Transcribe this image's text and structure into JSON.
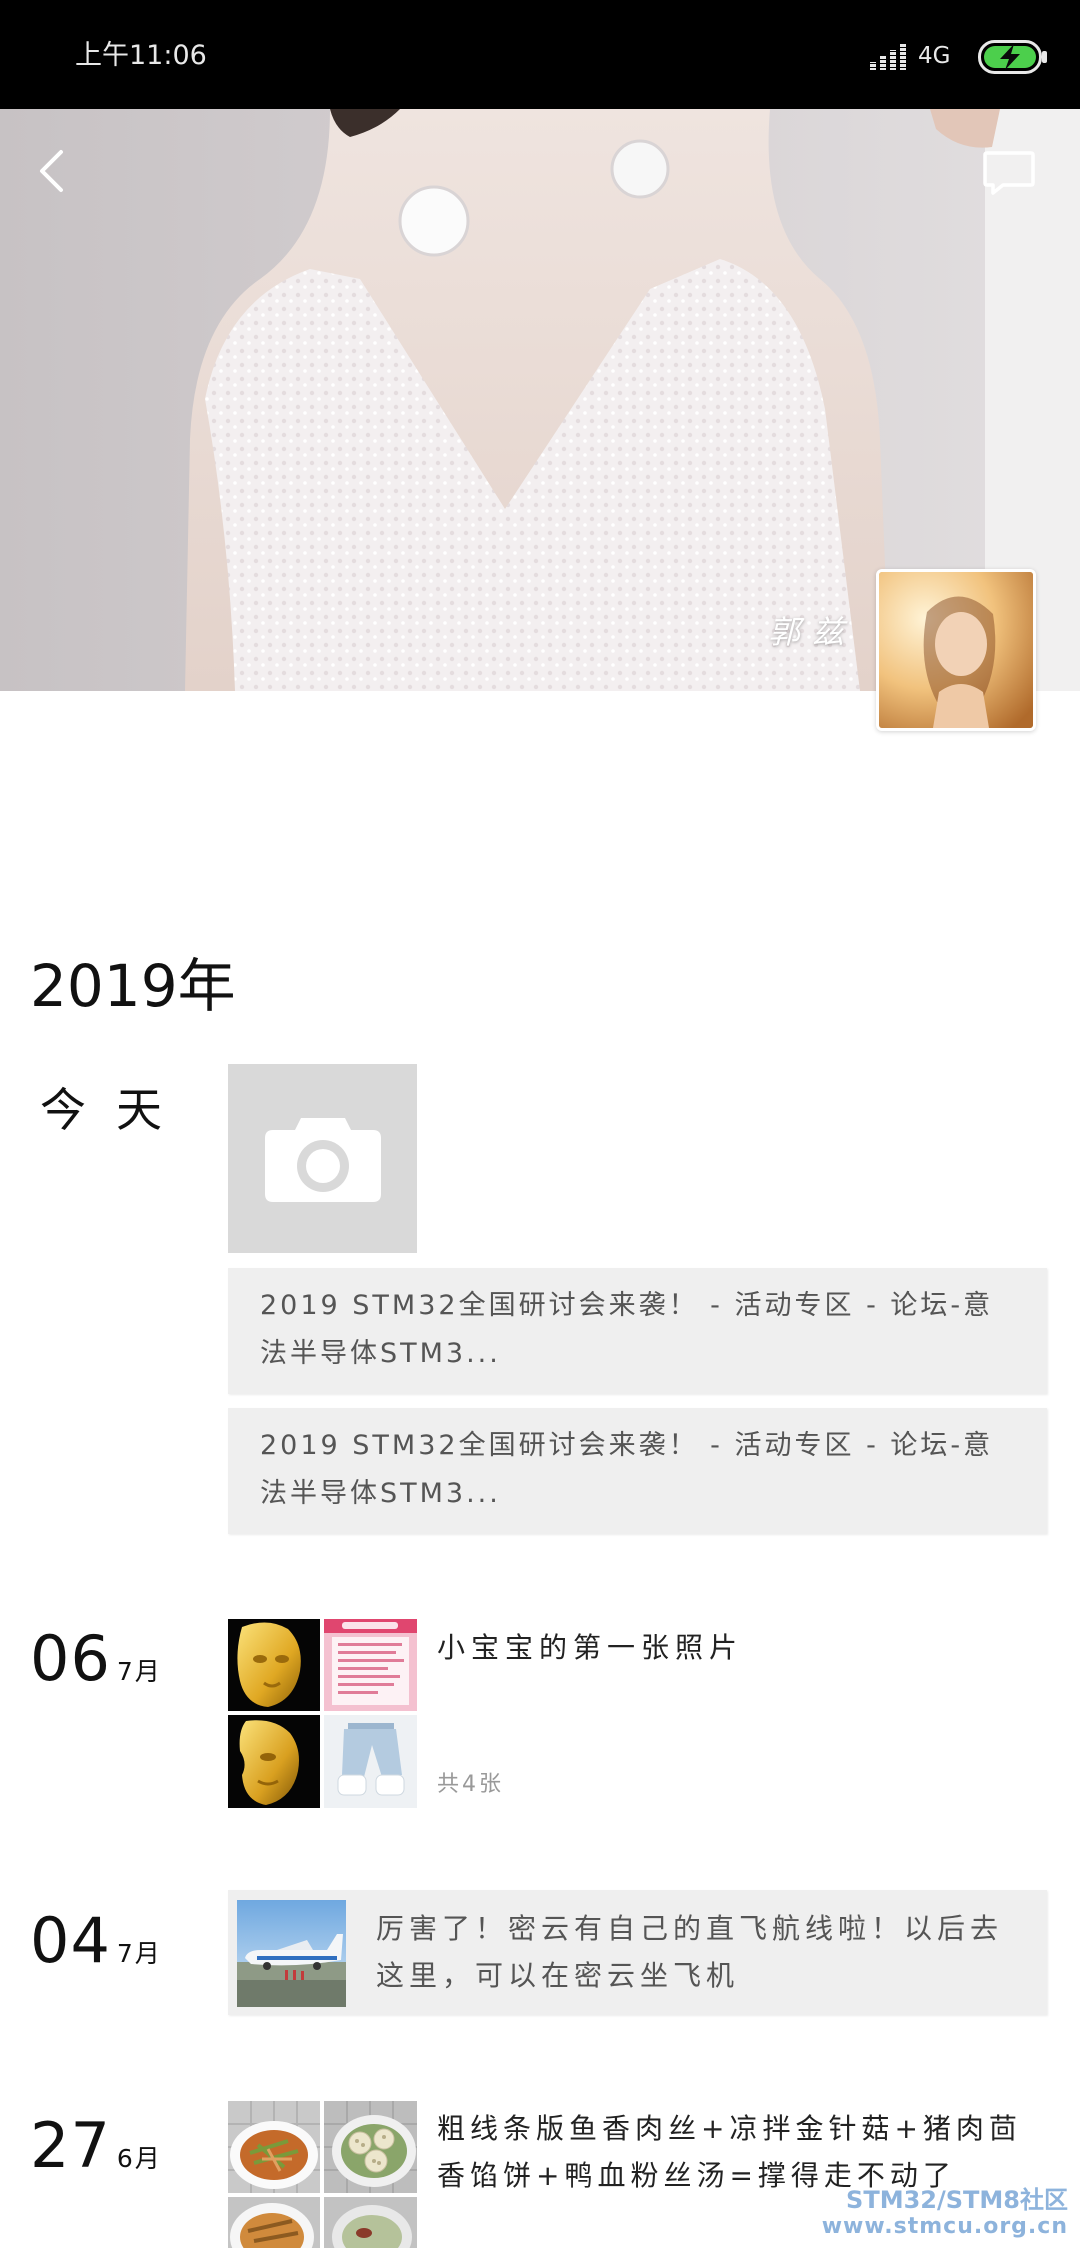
{
  "status_bar": {
    "time": "上午11:06",
    "network": "4G"
  },
  "cover": {
    "name": "郭兹"
  },
  "timeline": {
    "year": "2019年",
    "today": {
      "label": "今天",
      "links": [
        {
          "text": "2019 STM32全国研讨会来袭！ - 活动专区 - 论坛-意法半导体STM3..."
        },
        {
          "text": "2019 STM32全国研讨会来袭！ - 活动专区 - 论坛-意法半导体STM3..."
        }
      ]
    },
    "entries": [
      {
        "day": "06",
        "month": "7月",
        "text": "小宝宝的第一张照片",
        "photo_count": "共4张"
      },
      {
        "day": "04",
        "month": "7月",
        "text": "厉害了！密云有自己的直飞航线啦！以后去这里，可以在密云坐飞机"
      },
      {
        "day": "27",
        "month": "6月",
        "text": "粗线条版鱼香肉丝+凉拌金针菇+猪肉茴香馅饼+鸭血粉丝汤=撑得走不动了"
      }
    ]
  },
  "watermark": {
    "line1": "STM32/STM8社区",
    "line2": "www.stmcu.org.cn"
  },
  "icons": {
    "back": "chevron-left-icon",
    "comment": "comment-icon",
    "camera": "camera-icon",
    "signal": "signal-icon",
    "battery": "battery-charging-icon"
  },
  "colors": {
    "status_bar_bg": "#000000",
    "battery_fill": "#4ccf4c",
    "page_bg": "#ffffff",
    "card_bg": "#efefef",
    "placeholder_bg": "#d9d9d9",
    "text_primary": "#222222",
    "text_secondary": "#555555",
    "text_muted": "#999999",
    "watermark": "#7aa6d6"
  }
}
